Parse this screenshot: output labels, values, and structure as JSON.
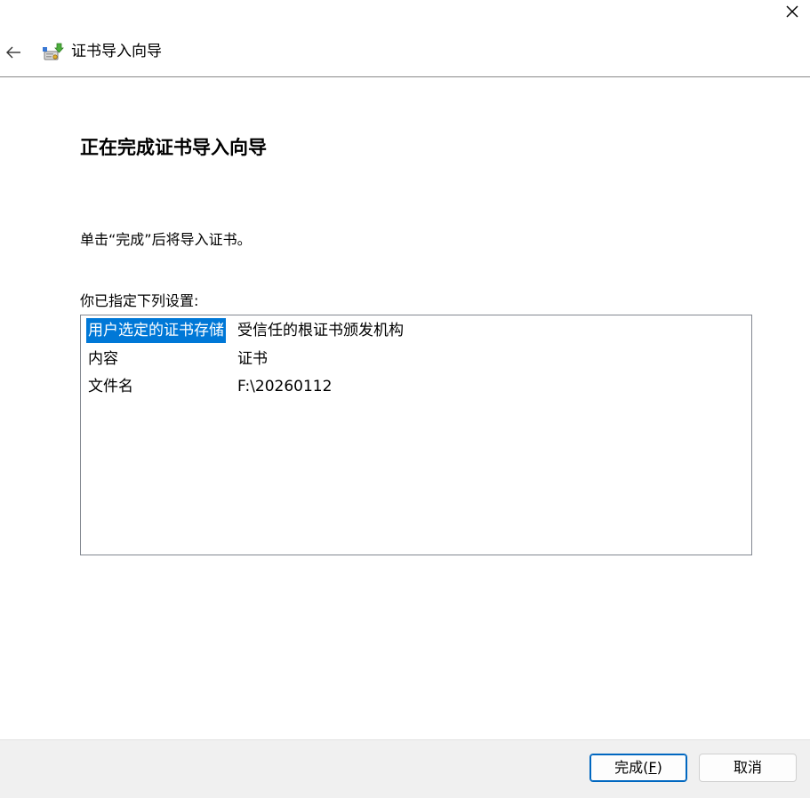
{
  "window": {
    "close_label": "✕"
  },
  "header": {
    "back_label": "←",
    "title": "证书导入向导",
    "icon": "certificate-import-icon"
  },
  "main": {
    "heading": "正在完成证书导入向导",
    "instruction": "单击“完成”后将导入证书。",
    "settings_label": "你已指定下列设置:",
    "settings": [
      {
        "key": "用户选定的证书存储",
        "value": "受信任的根证书颁发机构",
        "selected": true
      },
      {
        "key": "内容",
        "value": "证书",
        "selected": false
      },
      {
        "key": "文件名",
        "value": "F:\\20260112",
        "selected": false
      }
    ]
  },
  "footer": {
    "finish_label_pre": "完成(",
    "finish_label_key": "F",
    "finish_label_post": ")",
    "cancel_label": "取消"
  },
  "colors": {
    "selection": "#0078d7",
    "primary_border": "#0067c0",
    "footer_bg": "#f0f0f0"
  }
}
